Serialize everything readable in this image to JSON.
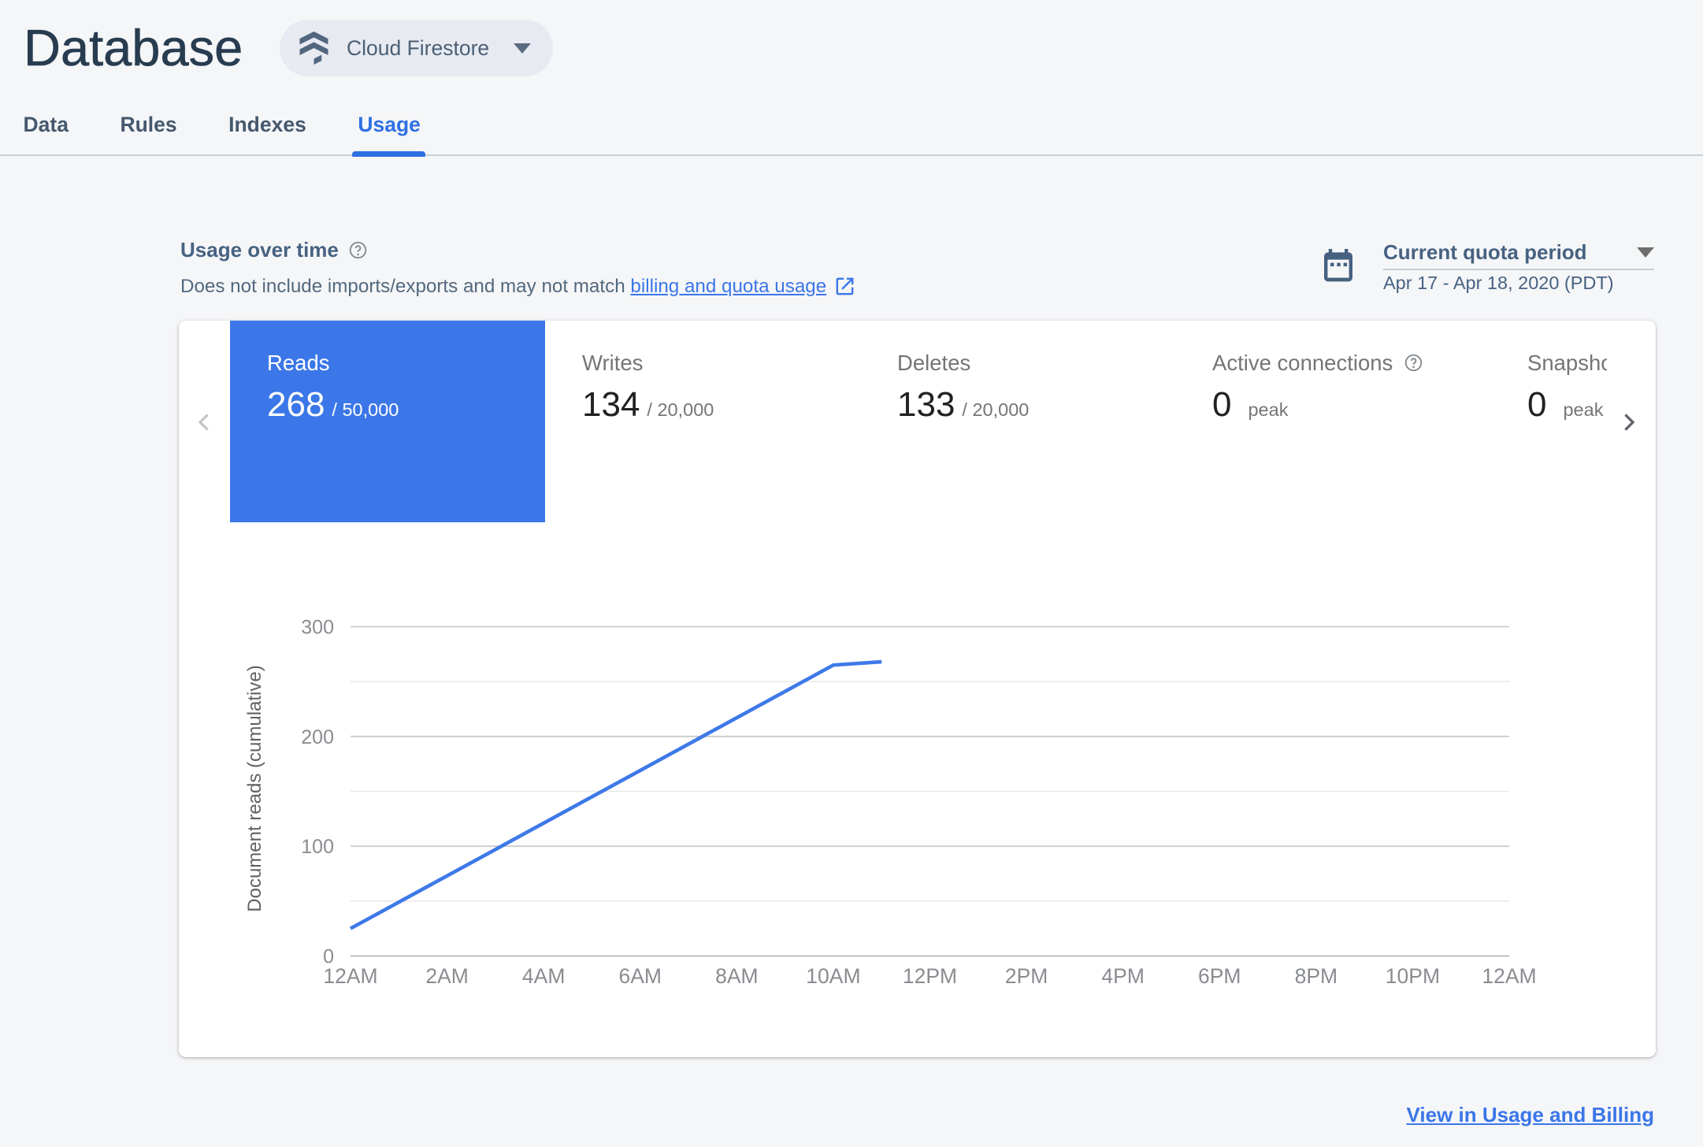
{
  "header": {
    "title": "Database",
    "product_selector": {
      "label": "Cloud Firestore"
    }
  },
  "tabs": [
    {
      "label": "Data",
      "active": false
    },
    {
      "label": "Rules",
      "active": false
    },
    {
      "label": "Indexes",
      "active": false
    },
    {
      "label": "Usage",
      "active": true
    }
  ],
  "usage_section": {
    "heading": "Usage over time",
    "description_prefix": "Does not include imports/exports and may not match ",
    "description_link": "billing and quota usage",
    "period_selector": {
      "label": "Current quota period",
      "range": "Apr 17 - Apr 18, 2020 (PDT)"
    }
  },
  "metrics": [
    {
      "label": "Reads",
      "value": "268",
      "quota": "/ 50,000",
      "selected": true,
      "help": false
    },
    {
      "label": "Writes",
      "value": "134",
      "quota": "/ 20,000",
      "selected": false,
      "help": false
    },
    {
      "label": "Deletes",
      "value": "133",
      "quota": "/ 20,000",
      "selected": false,
      "help": false
    },
    {
      "label": "Active connections",
      "value": "0",
      "quota": "peak",
      "selected": false,
      "help": true
    },
    {
      "label": "Snapshot listeners",
      "value": "0",
      "quota": "peak",
      "selected": false,
      "help": false
    }
  ],
  "chart_data": {
    "type": "line",
    "title": "",
    "xlabel": "",
    "ylabel": "Document reads (cumulative)",
    "x_ticks": [
      "12AM",
      "2AM",
      "4AM",
      "6AM",
      "8AM",
      "10AM",
      "12PM",
      "2PM",
      "4PM",
      "6PM",
      "8PM",
      "10PM",
      "12AM"
    ],
    "x_range_hours": [
      0,
      24
    ],
    "y_ticks": [
      0,
      100,
      200,
      300
    ],
    "y_minor_gridlines": [
      50,
      150,
      250
    ],
    "ylim": [
      0,
      300
    ],
    "grid": true,
    "legend_position": "none",
    "series": [
      {
        "name": "Document reads (cumulative)",
        "x_hours": [
          0,
          10,
          11
        ],
        "values": [
          25,
          265,
          268
        ]
      }
    ]
  },
  "footer": {
    "link": "View in Usage and Billing"
  },
  "colors": {
    "accent_blue": "#3b77e8",
    "chart_line": "#3e79e8",
    "active_tab": "#2e70e3",
    "page_background": "#f5f6f8",
    "card_background": "#ffffff",
    "title_text": "#283c50",
    "slate_text": "#476282",
    "metric_label_gray": "#757575",
    "metric_value_black": "#212121",
    "axis_label_gray": "#898c90",
    "gridline_major": "#cccccc",
    "gridline_minor": "#e9e9e9",
    "axis_baseline": "#b7b7b7"
  }
}
